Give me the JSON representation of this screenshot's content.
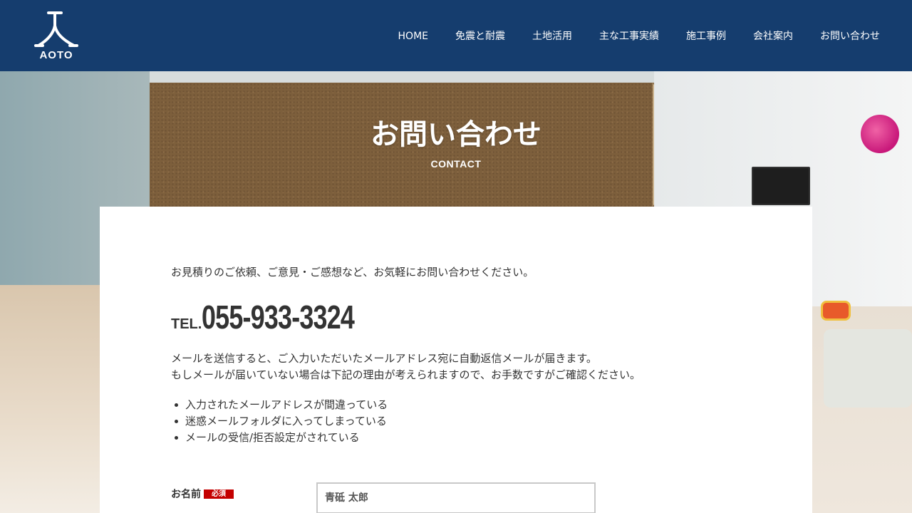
{
  "header": {
    "logo_text": "AOTO",
    "nav": [
      "HOME",
      "免震と耐震",
      "土地活用",
      "主な工事実績",
      "施工事例",
      "会社案内",
      "お問い合わせ"
    ]
  },
  "hero": {
    "title": "お問い合わせ",
    "subtitle": "CONTACT"
  },
  "content": {
    "intro": "お見積りのご依頼、ご意見・ご感想など、お気軽にお問い合わせください。",
    "tel_label": "TEL.",
    "tel_number": "055-933-3324",
    "notice_line1": "メールを送信すると、ご入力いただいたメールアドレス宛に自動返信メールが届きます。",
    "notice_line2": "もしメールが届いていない場合は下記の理由が考えられますので、お手数ですがご確認ください。",
    "reasons": [
      "入力されたメールアドレスが間違っている",
      "迷惑メールフォルダに入ってしまっている",
      "メールの受信/拒否設定がされている"
    ]
  },
  "form": {
    "name_label": "お名前",
    "required_badge": "必須",
    "name_placeholder": "青砥 太郎"
  },
  "colors": {
    "header_bg": "#153d6e",
    "required_red": "#c40000"
  }
}
